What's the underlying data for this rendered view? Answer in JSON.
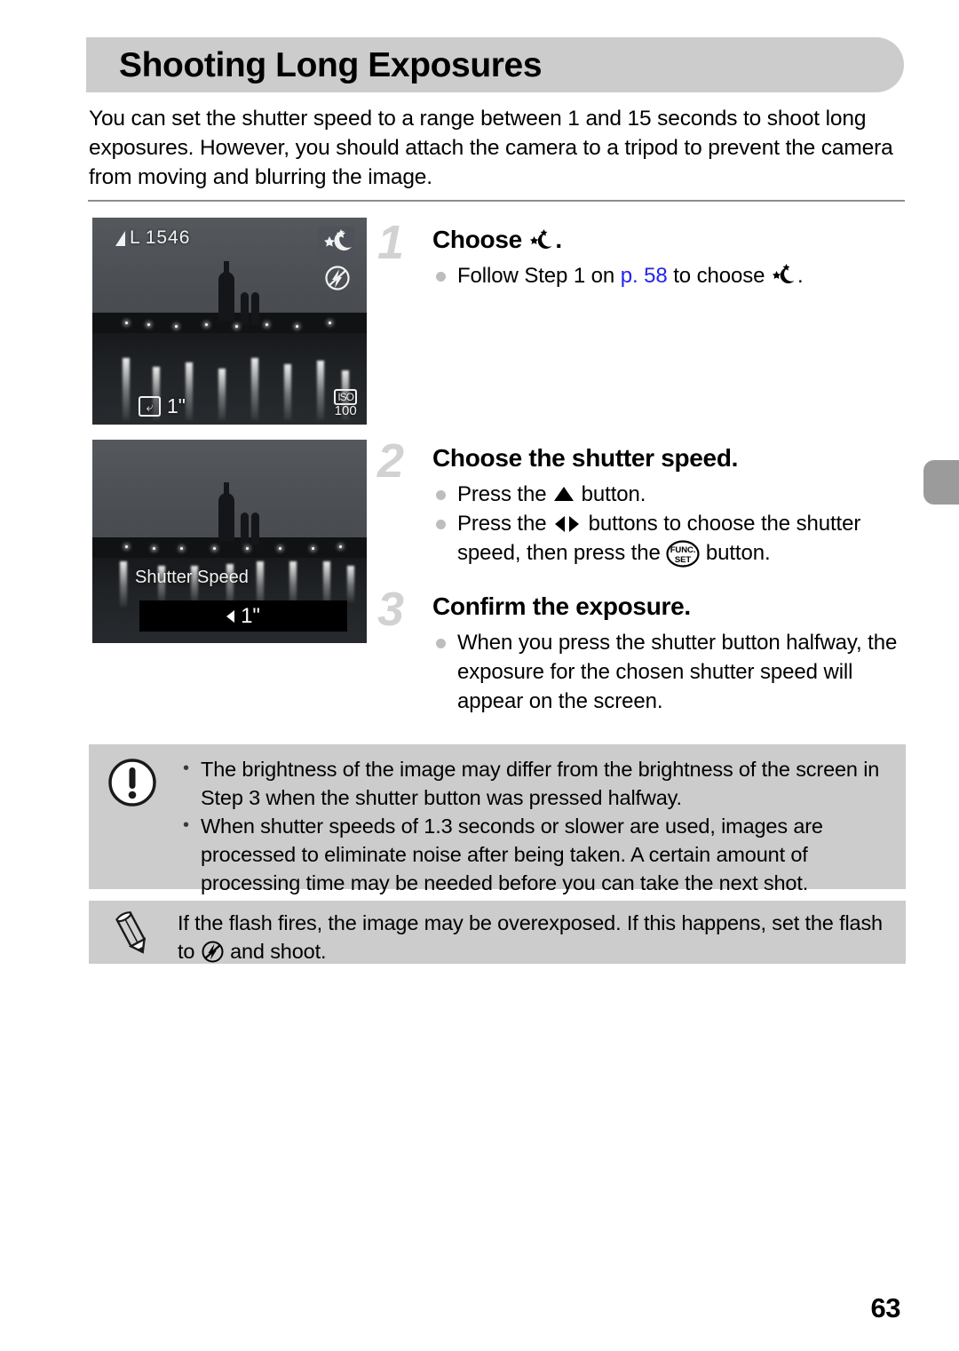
{
  "page": {
    "title": "Shooting Long Exposures",
    "number": "63",
    "intro": "You can set the shutter speed to a range between 1 and 15 seconds to shoot long exposures. However, you should attach the camera to a tripod to prevent the camera from moving and blurring the image."
  },
  "screens": {
    "screen1": {
      "quality_label": "L",
      "shots_remaining": "1546",
      "mode_icon": "long-shutter-stars-moon-icon",
      "flash_icon": "flash-off-icon",
      "exposure_icon": "exposure-compensation-icon",
      "shutter_value": "1\"",
      "iso_label": "ISO",
      "iso_value": "100"
    },
    "screen2": {
      "setting_label": "Shutter Speed",
      "setting_value": "1\"",
      "left_arrow_icon": "left-arrow-icon"
    }
  },
  "steps": [
    {
      "number": "1",
      "title_prefix": "Choose ",
      "title_suffix": ".",
      "title_icon": "long-shutter-stars-moon-icon",
      "bullets": [
        {
          "prefix": "Follow Step 1 on ",
          "link": "p. 58",
          "middle": " to choose ",
          "icon": "long-shutter-stars-moon-icon",
          "suffix": "."
        }
      ]
    },
    {
      "number": "2",
      "title": "Choose the shutter speed.",
      "bullets": [
        {
          "prefix": "Press the ",
          "icon": "up-arrow-button-icon",
          "suffix": " button."
        },
        {
          "prefix": "Press the ",
          "icon": "left-right-arrow-buttons-icon",
          "middle": " buttons to choose the shutter speed, then press the ",
          "icon2": "func-set-button-icon",
          "suffix": " button."
        }
      ]
    },
    {
      "number": "3",
      "title": "Confirm the exposure.",
      "bullets": [
        {
          "text": "When you press the shutter button halfway, the exposure for the chosen shutter speed will appear on the screen."
        }
      ]
    }
  ],
  "caution": {
    "icon": "exclamation-circle-icon",
    "items": [
      "The brightness of the image may differ from the brightness of the screen in Step 3 when the shutter button was pressed halfway.",
      "When shutter speeds of 1.3 seconds or slower are used, images are processed to eliminate noise after being taken. A certain amount of processing time may be needed before you can take the next shot."
    ]
  },
  "note": {
    "icon": "pencil-icon",
    "prefix": "If the flash fires, the image may be overexposed. If this happens, set the flash to ",
    "icon_inline": "flash-off-icon",
    "suffix": " and shoot."
  },
  "colors": {
    "banner_gray": "#cccccc",
    "step_number_gray": "#d2d2d2",
    "link_blue": "#2222ee",
    "tab_gray": "#9b9b9b"
  }
}
